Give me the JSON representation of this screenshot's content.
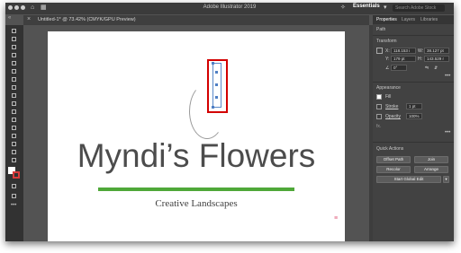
{
  "app": {
    "title": "Adobe Illustrator 2019",
    "workspace": "Essentials",
    "search_placeholder": "Search Adobe Stock"
  },
  "document": {
    "tab_label": "Untitled-1* @ 73.42% (CMYK/GPU Preview)",
    "collapse_label": "«"
  },
  "artboard": {
    "logo_text": "Myndi’s Flowers",
    "tagline": "Creative Landscapes",
    "accent_color": "#4fa839"
  },
  "panel": {
    "tabs": [
      "Properties",
      "Layers",
      "Libraries"
    ],
    "path_label": "Path",
    "transform": {
      "heading": "Transform",
      "x_label": "X:",
      "x_value": "118.153 i",
      "w_label": "W:",
      "w_value": "38.127 pt",
      "y_label": "Y:",
      "y_value": "179 pt",
      "h_label": "H:",
      "h_value": "143.529 r",
      "angle_value": "0°"
    },
    "appearance": {
      "heading": "Appearance",
      "fill_label": "Fill",
      "stroke_label": "Stroke",
      "stroke_value": "1 pt",
      "opacity_label": "Opacity",
      "opacity_value": "100%",
      "fx_label": "fx."
    },
    "quick_actions": {
      "heading": "Quick Actions",
      "offset_path": "Offset Path",
      "join": "Join",
      "recolor": "Recolor",
      "arrange": "Arrange",
      "start_global_edit": "Start Global Edit"
    },
    "more_label": "•••"
  }
}
